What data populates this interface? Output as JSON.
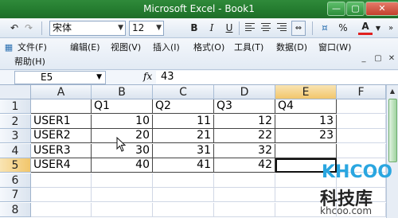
{
  "window": {
    "title": "Microsoft Excel - Book1",
    "buttons": [
      "minimize",
      "maximize",
      "close"
    ]
  },
  "toolbar": {
    "font_name": "宋体",
    "font_size": "12",
    "bold": "B",
    "italic": "I",
    "underline": "U",
    "percent": "%",
    "font_color_label": "A",
    "font_color": "#e02020"
  },
  "menu": {
    "items": [
      "文件(F)",
      "编辑(E)",
      "视图(V)",
      "插入(I)",
      "格式(O)",
      "工具(T)",
      "数据(D)",
      "窗口(W)"
    ],
    "help": "帮助(H)"
  },
  "formula_bar": {
    "name_box": "E5",
    "fx": "fx",
    "value": "43"
  },
  "grid": {
    "columns": [
      "A",
      "B",
      "C",
      "D",
      "E",
      "F"
    ],
    "selected_column": "E",
    "rows": [
      "1",
      "2",
      "3",
      "4",
      "5",
      "6",
      "7",
      "8"
    ],
    "selected_row": "5",
    "data": [
      [
        "",
        "Q1",
        "Q2",
        "Q3",
        "Q4",
        ""
      ],
      [
        "USER1",
        "10",
        "11",
        "12",
        "13",
        ""
      ],
      [
        "USER2",
        "20",
        "21",
        "22",
        "23",
        ""
      ],
      [
        "USER3",
        "30",
        "31",
        "32",
        "",
        ""
      ],
      [
        "USER4",
        "40",
        "41",
        "42",
        "",
        ""
      ],
      [
        "",
        "",
        "",
        "",
        "",
        ""
      ],
      [
        "",
        "",
        "",
        "",
        "",
        ""
      ],
      [
        "",
        "",
        "",
        "",
        "",
        ""
      ]
    ]
  },
  "watermark": {
    "logo": "KHCOO",
    "chinese": "科技库",
    "url": "khcoo.com"
  }
}
